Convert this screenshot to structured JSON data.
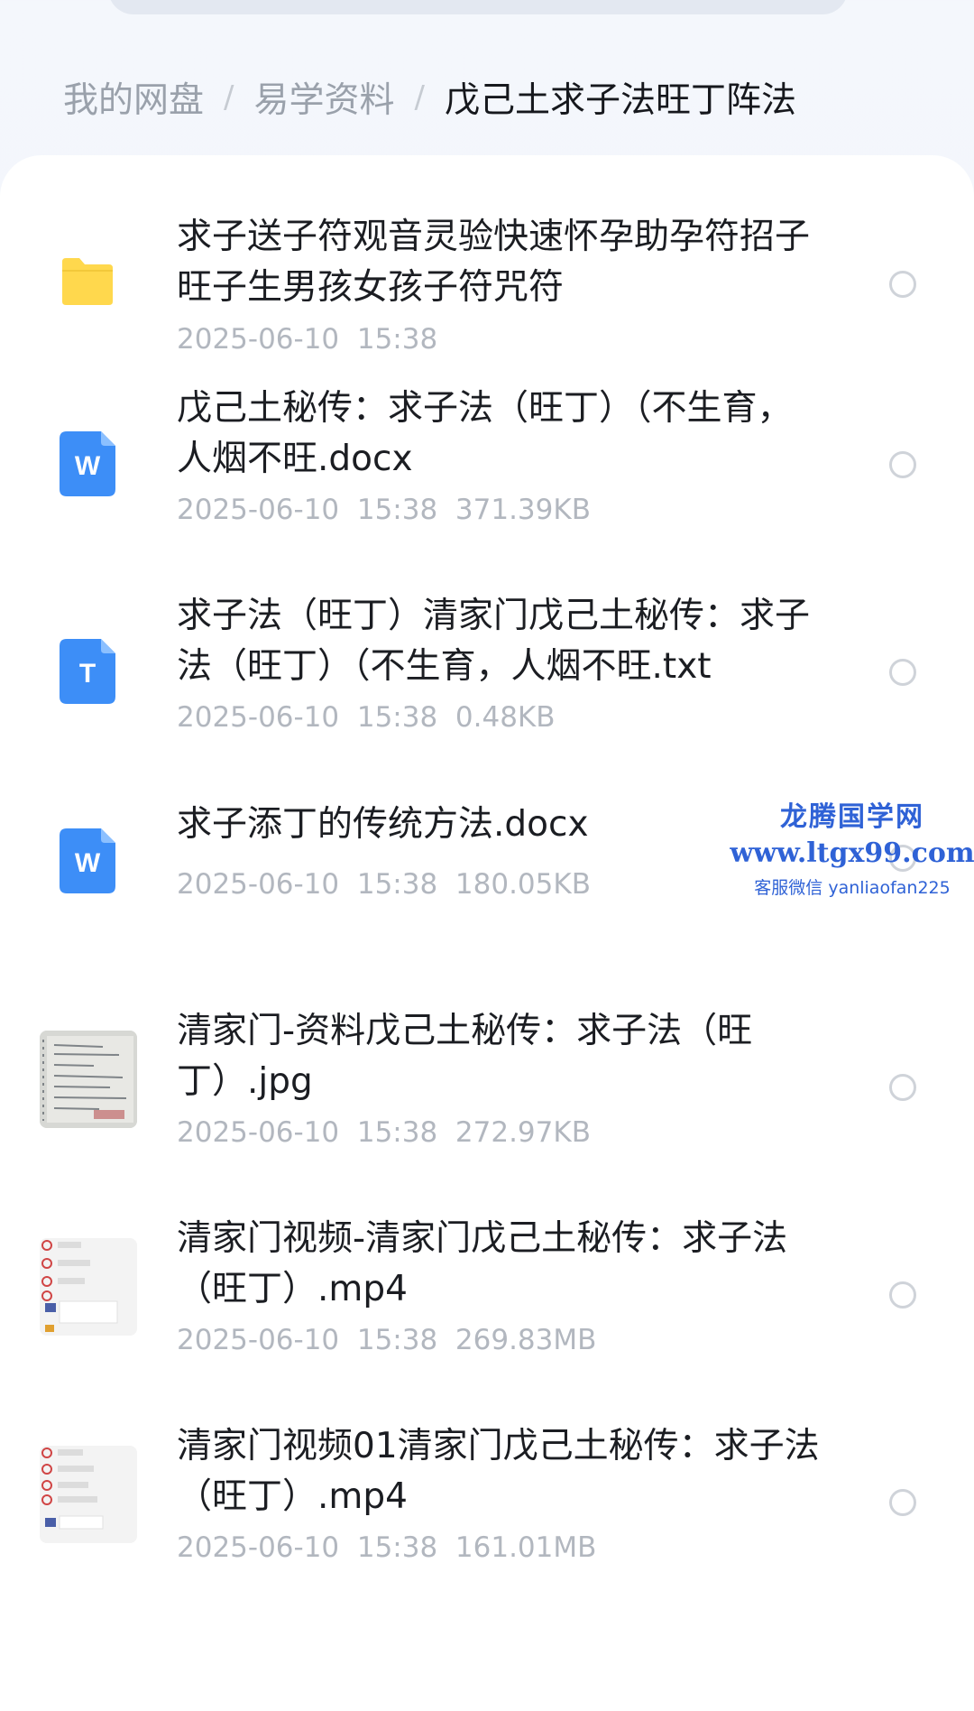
{
  "breadcrumb": {
    "root": "我的网盘",
    "parent": "易学资料",
    "current": "戊己土求子法旺丁阵法",
    "separator": "/"
  },
  "files": [
    {
      "type": "folder",
      "icon": "folder-icon",
      "name_line1": "求子送子符观音灵验快速怀孕助孕符招子",
      "name_line2": "旺子生男孩女孩子符咒符",
      "meta": "2025-06-10  15:38"
    },
    {
      "type": "docx",
      "icon": "word-doc-icon",
      "icon_letter": "W",
      "name_line1": "戊己土秘传：求子法（旺丁）（不生育，",
      "name_line2": "人烟不旺.docx",
      "meta": "2025-06-10  15:38  371.39KB"
    },
    {
      "type": "txt",
      "icon": "text-file-icon",
      "icon_letter": "T",
      "name_line1": "求子法（旺丁）清家门戊己土秘传：求子",
      "name_line2": "法（旺丁）（不生育，人烟不旺.txt",
      "meta": "2025-06-10  15:38  0.48KB"
    },
    {
      "type": "docx",
      "icon": "word-doc-icon",
      "icon_letter": "W",
      "name_line1": "求子添丁的传统方法.docx",
      "name_line2": "",
      "meta": "2025-06-10  15:38  180.05KB"
    },
    {
      "type": "jpg",
      "icon": "image-thumbnail",
      "name_line1": "清家门-资料戊己土秘传：求子法（旺",
      "name_line2": "丁）.jpg",
      "meta": "2025-06-10  15:38  272.97KB"
    },
    {
      "type": "mp4",
      "icon": "video-thumbnail",
      "name_line1": "清家门视频-清家门戊己土秘传：求子法",
      "name_line2": "（旺丁）.mp4",
      "meta": "2025-06-10  15:38  269.83MB"
    },
    {
      "type": "mp4",
      "icon": "video-thumbnail",
      "name_line1": "清家门视频01清家门戊己土秘传：求子法",
      "name_line2": "（旺丁）.mp4",
      "meta": "2025-06-10  15:38  161.01MB"
    }
  ],
  "watermark": {
    "title": "龙腾国学网",
    "url": "www.ltgx99.com",
    "contact": "客服微信 yanliaofan225"
  },
  "colors": {
    "folder": "#ffd84d",
    "doc_icon": "#3d8ef7",
    "watermark": "#2f62d6"
  }
}
